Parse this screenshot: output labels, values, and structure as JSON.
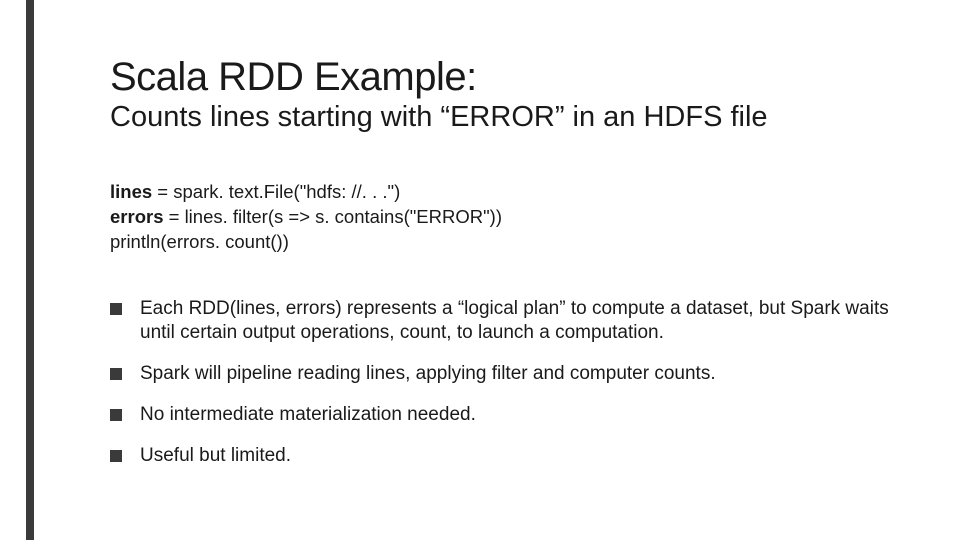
{
  "slide": {
    "title": "Scala RDD Example:",
    "subtitle": "Counts lines starting with “ERROR” in an HDFS file",
    "code": {
      "line1_bold": "lines",
      "line1_rest": " = spark. text.File(\"hdfs: //. . .\")",
      "line2_bold": "errors",
      "line2_rest": " = lines. filter(s => s. contains(\"ERROR\"))",
      "line3": "println(errors. count())"
    },
    "bullets": [
      "Each RDD(lines, errors) represents a “logical plan” to compute a dataset, but Spark waits until certain output operations, count, to launch a computation.",
      "Spark will pipeline reading lines, applying filter and computer counts.",
      "No intermediate materialization needed.",
      "Useful but limited."
    ]
  }
}
